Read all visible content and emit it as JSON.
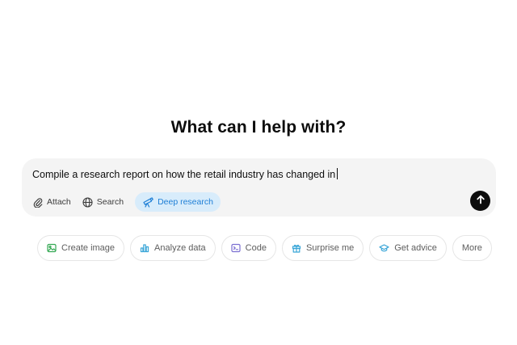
{
  "heading": "What can I help with?",
  "composer": {
    "prompt_text": "Compile a research report on how the retail industry has changed in",
    "tools": [
      {
        "label": "Attach",
        "icon": "paperclip-icon"
      },
      {
        "label": "Search",
        "icon": "globe-icon"
      },
      {
        "label": "Deep research",
        "icon": "telescope-icon",
        "active": true,
        "color": "#1f7fd6"
      }
    ],
    "send_icon": "arrow-up-icon"
  },
  "suggestions": [
    {
      "label": "Create image",
      "icon": "image-icon",
      "color": "#34a853"
    },
    {
      "label": "Analyze data",
      "icon": "bar-chart-icon",
      "color": "#3aa6d8"
    },
    {
      "label": "Code",
      "icon": "terminal-icon",
      "color": "#7b6fd1"
    },
    {
      "label": "Surprise me",
      "icon": "gift-icon",
      "color": "#3aa6d8"
    },
    {
      "label": "Get advice",
      "icon": "graduation-cap-icon",
      "color": "#3aa6d8"
    },
    {
      "label": "More"
    }
  ]
}
